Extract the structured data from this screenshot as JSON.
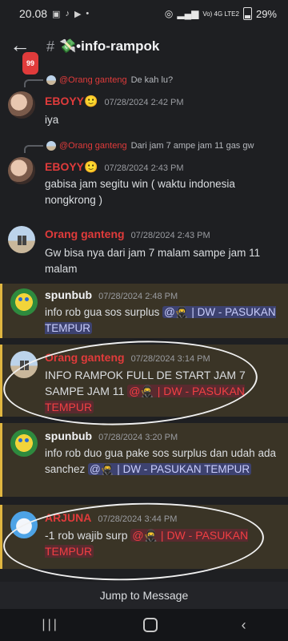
{
  "status": {
    "time": "20.08",
    "battery": "29%",
    "net": "Vo) 4G LTE2"
  },
  "header": {
    "unread": "99",
    "hash": "#",
    "channel": "💸•info-rampok"
  },
  "messages": [
    {
      "reply_name": "@Orang ganteng",
      "reply_text": "De kah lu?",
      "name": "EBOYY🙂",
      "time": "07/28/2024 2:42 PM",
      "text": "iya"
    },
    {
      "reply_name": "@Orang ganteng",
      "reply_text": "Dari jam 7 ampe jam 11 gas gw",
      "name": "EBOYY🙂",
      "time": "07/28/2024 2:43 PM",
      "text": "gabisa jam segitu win ( waktu indonesia nongkrong )"
    },
    {
      "name": "Orang ganteng",
      "time": "07/28/2024 2:43 PM",
      "text": "Gw bisa nya dari jam 7 malam sampe jam 11 malam"
    },
    {
      "name": "spunbub",
      "time": "07/28/2024 2:48 PM",
      "text": "info rob gua sos surplus ",
      "role": "@🥷 | DW - PASUKAN TEMPUR"
    },
    {
      "name": "Orang ganteng",
      "time": "07/28/2024 3:14 PM",
      "text": "INFO RAMPOK FULL DE START JAM 7 SAMPE JAM 11 ",
      "role": "@🥷 | DW - PASUKAN TEMPUR"
    },
    {
      "name": "spunbub",
      "time": "07/28/2024 3:20 PM",
      "text": "info rob duo gua pake sos surplus dan udah ada sanchez ",
      "role": "@🥷 | DW - PASUKAN TEMPUR"
    },
    {
      "name": "ARJUNA",
      "time": "07/28/2024 3:44 PM",
      "text": "-1 rob wajib surp ",
      "role": "@🥷 | DW - PASUKAN TEMPUR"
    }
  ],
  "jump_label": "Jump to Message",
  "colors": {
    "red_name": "#f23f43",
    "blue_role": "#3d4270",
    "mention_bg": "#3a3426"
  }
}
